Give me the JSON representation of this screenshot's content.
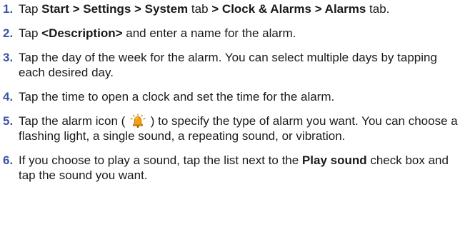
{
  "steps": [
    {
      "number": "1.",
      "parts": [
        "Tap ",
        "Start > Settings > System",
        " tab ",
        "> Clock & Alarms > Alarms",
        " tab."
      ]
    },
    {
      "number": "2.",
      "parts": [
        "Tap ",
        "<Description>",
        " and enter a name for the alarm."
      ]
    },
    {
      "number": "3.",
      "parts": [
        "Tap the day of the week for the alarm. You can select multiple days by tapping each desired day."
      ]
    },
    {
      "number": "4.",
      "parts": [
        "Tap the time to open a clock and set the time for the alarm."
      ]
    },
    {
      "number": "5.",
      "parts": [
        "Tap the alarm icon ( ",
        " ) to specify the type of alarm you want. You can choose a flashing light, a single sound, a repeating sound, or vibration."
      ]
    },
    {
      "number": "6.",
      "parts": [
        "If you choose to play a sound, tap the list next to the ",
        "Play sound",
        " check box and tap the sound you want."
      ]
    }
  ],
  "icons": {
    "alarm": "alarm-bell-icon"
  },
  "colors": {
    "step_number": "#3b55a3",
    "text": "#1a1a1a",
    "icon_bell": "#f2a20c"
  }
}
